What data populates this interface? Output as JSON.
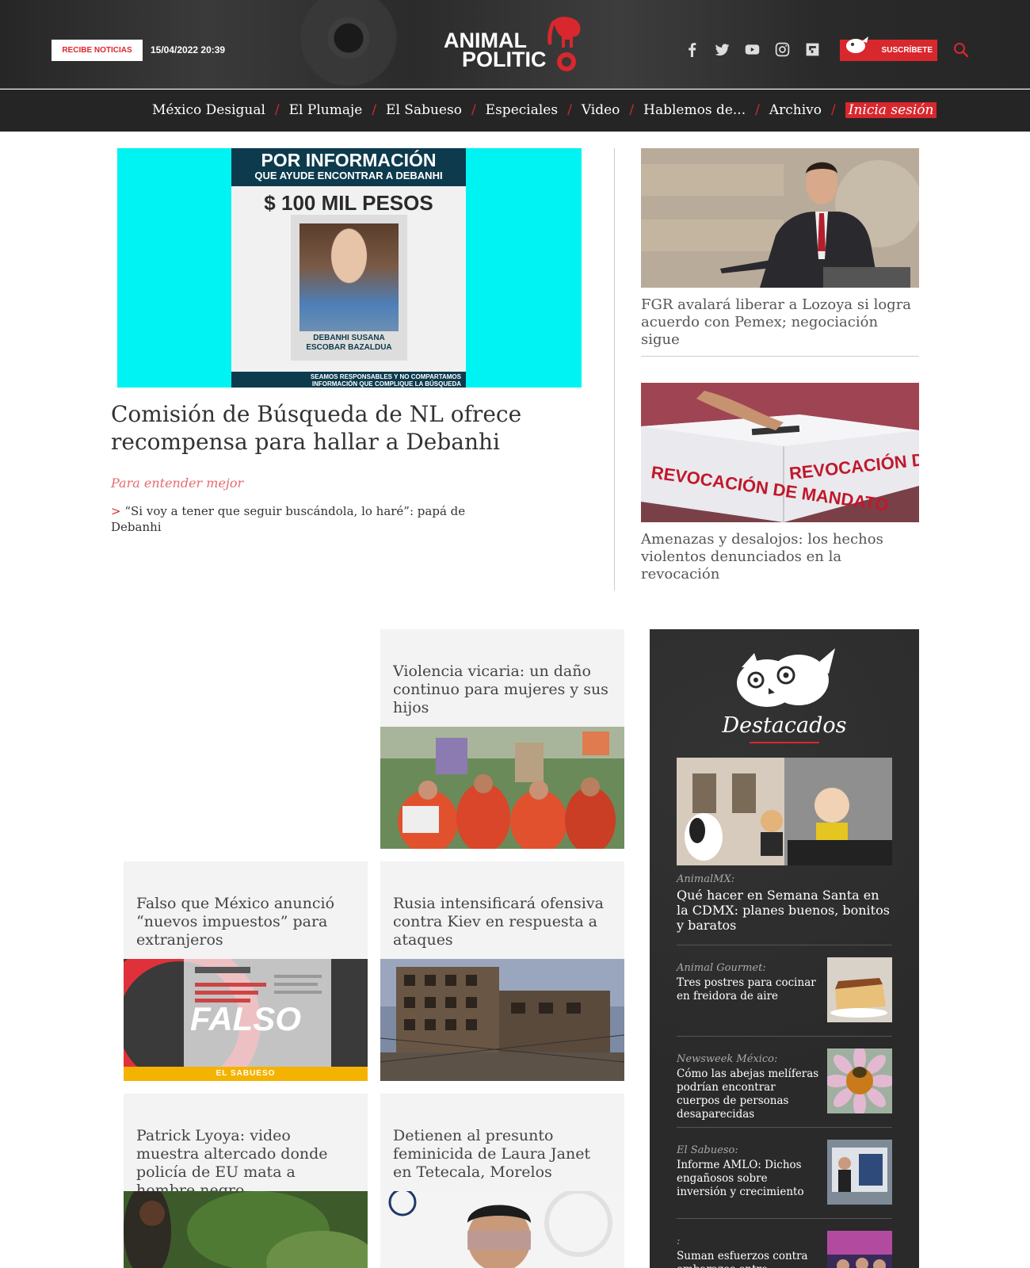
{
  "header": {
    "recibe_label": "RECIBE NOTICIAS",
    "date": "15/04/2022 20:39",
    "logo_line1": "ANIMAL",
    "logo_line2": "POLITIC",
    "subscribe_label": "SUSCRÍBETE",
    "social_icons": [
      "facebook-icon",
      "twitter-icon",
      "youtube-icon",
      "instagram-icon",
      "flipboard-icon"
    ],
    "accent": "#d9272e"
  },
  "nav": {
    "items": [
      "México Desigual",
      "El Plumaje",
      "El Sabueso",
      "Especiales",
      "Video",
      "Hablemos de...",
      "Archivo"
    ],
    "separator": "/",
    "login": "Inicia sesión"
  },
  "lead": {
    "poster_heading": "POR INFORMACIÓN",
    "poster_sub": "QUE AYUDE ENCONTRAR A DEBANHI",
    "poster_reward": "$ 100 MIL PESOS",
    "poster_name_1": "DEBANHI SUSANA",
    "poster_name_2": "ESCOBAR BAZALDUA",
    "poster_footer_1": "SEAMOS RESPONSABLES Y NO COMPARTAMOS",
    "poster_footer_2": "INFORMACIÓN QUE COMPLIQUE LA BÚSQUEDA",
    "title": "Comisión de Búsqueda de NL ofrece recompensa para hallar a Debanhi",
    "related_label": "Para entender mejor",
    "related_marker": ">",
    "related_link": "“Si voy a tener que seguir buscándola, lo haré”: papá de Debanhi"
  },
  "side": [
    {
      "title": "FGR avalará liberar a Lozoya si logra acuerdo con Pemex; negociación sigue"
    },
    {
      "title": "Amenazas y desalojos: los hechos violentos denunciados en la revocación",
      "ballot_text": "REVOCACIÓN DE MANDATO"
    }
  ],
  "cards": [
    {
      "title": "Violencia vicaria: un daño continuo para mujeres y sus hijos"
    },
    {
      "title": "Falso que México anunció “nuevos impuestos” para extranjeros",
      "image_text": "FALSO",
      "tag": "EL SABUESO"
    },
    {
      "title": "Rusia intensificará ofensiva contra Kiev en respuesta a ataques"
    },
    {
      "title": "Patrick Lyoya: video muestra altercado donde policía de EU mata a hombre negro"
    },
    {
      "title": "Detienen al presunto feminicida de Laura Janet en Tetecala, Morelos"
    }
  ],
  "destacados": {
    "title": "Destacados",
    "main": {
      "category": "AnimalMX:",
      "title": "Qué hacer en Semana Santa en la CDMX: planes buenos, bonitos y baratos"
    },
    "items": [
      {
        "category": "Animal Gourmet:",
        "title": "Tres postres para cocinar en freidora de aire"
      },
      {
        "category": "Newsweek México:",
        "title": "Cómo las abejas melíferas podrían encontrar cuerpos de personas desaparecidas"
      },
      {
        "category": "El Sabueso:",
        "title": "Informe AMLO: Dichos engañosos sobre inversión y crecimiento"
      },
      {
        "category": ":",
        "title": "Suman esfuerzos contra embarazos entre"
      }
    ]
  }
}
